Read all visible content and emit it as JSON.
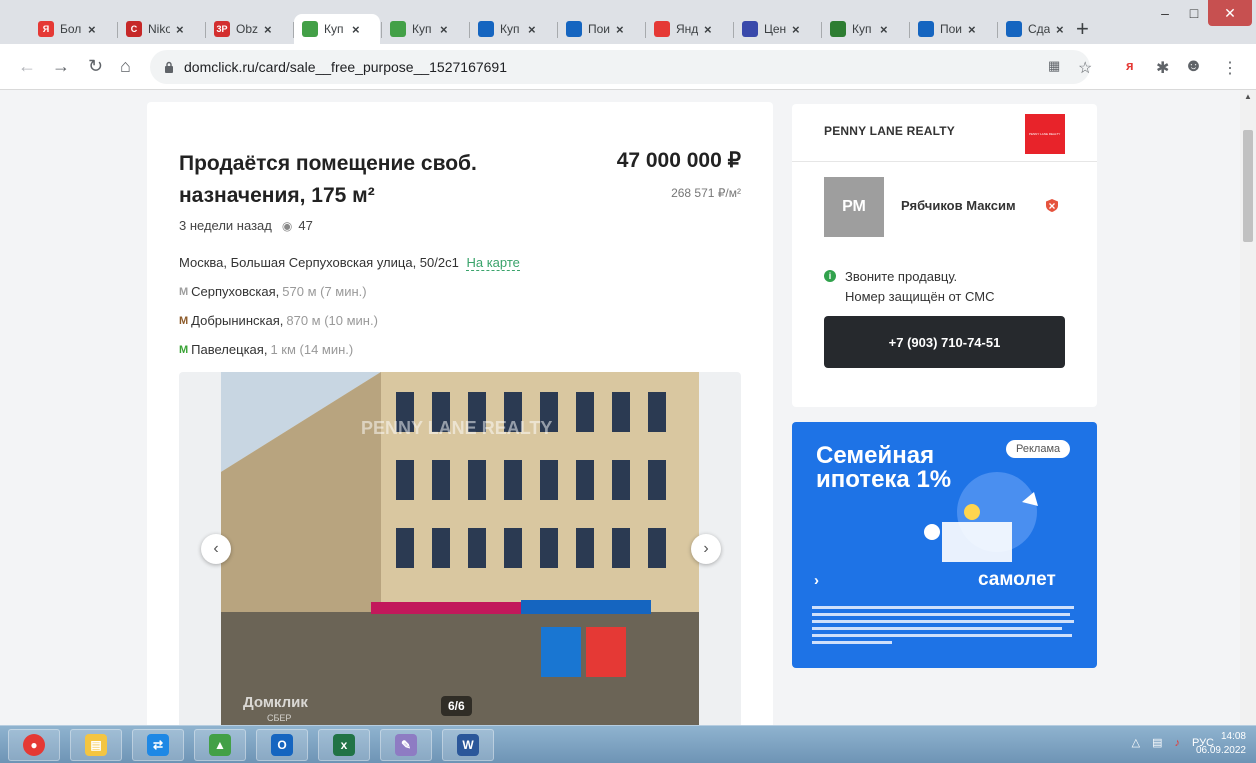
{
  "browser": {
    "tabs": [
      {
        "label": "Бол",
        "color": "#e53935",
        "glyph": "Я"
      },
      {
        "label": "Niko",
        "color": "#c62828",
        "glyph": "C"
      },
      {
        "label": "Obz",
        "color": "#d32f2f",
        "glyph": "3P"
      },
      {
        "label": "Куп",
        "color": "#43a047",
        "glyph": ""
      },
      {
        "label": "Куп",
        "color": "#43a047",
        "glyph": ""
      },
      {
        "label": "Куп",
        "color": "#1565c0",
        "glyph": ""
      },
      {
        "label": "Пои",
        "color": "#1565c0",
        "glyph": ""
      },
      {
        "label": "Янд",
        "color": "#e53935",
        "glyph": ""
      },
      {
        "label": "Цен",
        "color": "#3949ab",
        "glyph": ""
      },
      {
        "label": "Куп",
        "color": "#2e7d32",
        "glyph": ""
      },
      {
        "label": "Пои",
        "color": "#1565c0",
        "glyph": ""
      },
      {
        "label": "Сда",
        "color": "#1565c0",
        "glyph": ""
      }
    ],
    "active_tab_index": 3,
    "url": "domclick.ru/card/sale__free_purpose__1527167691"
  },
  "listing": {
    "title": "Продаётся помещение своб. назначения, 175 м²",
    "price": "47 000 000 ₽",
    "price_per_meter": "268 571 ₽/м²",
    "posted": "3 недели назад",
    "views": "47",
    "address": "Москва, Большая Серпуховская улица, 50/2с1",
    "map_link": "На карте",
    "metro": [
      {
        "station": "Серпуховская",
        "distance": "570 м (7 мин.)",
        "color": "#9e9e9e"
      },
      {
        "station": "Добрынинская",
        "distance": "870 м (10 мин.)",
        "color": "#8d5b2a"
      },
      {
        "station": "Павелецкая",
        "distance": "1 км (14 мин.)",
        "color": "#3aa336"
      }
    ],
    "photo_counter": "6/6",
    "watermark": "PENNY LANE REALTY",
    "domclick_watermark": "Домклик",
    "domclick_sub": "СБЕР"
  },
  "agent": {
    "agency": "PENNY LANE REALTY",
    "initials": "РМ",
    "name": "Рябчиков Максим",
    "call_line1": "Звоните продавцу.",
    "call_line2": "Номер защищён от СМС",
    "phone": "+7 (903) 710-74-51"
  },
  "ad": {
    "title": "Семейная ипотека 1%",
    "badge": "Реклама",
    "brand": "самолет"
  },
  "taskbar": {
    "lang": "РУС",
    "time": "14:08",
    "date": "06.09.2022"
  }
}
